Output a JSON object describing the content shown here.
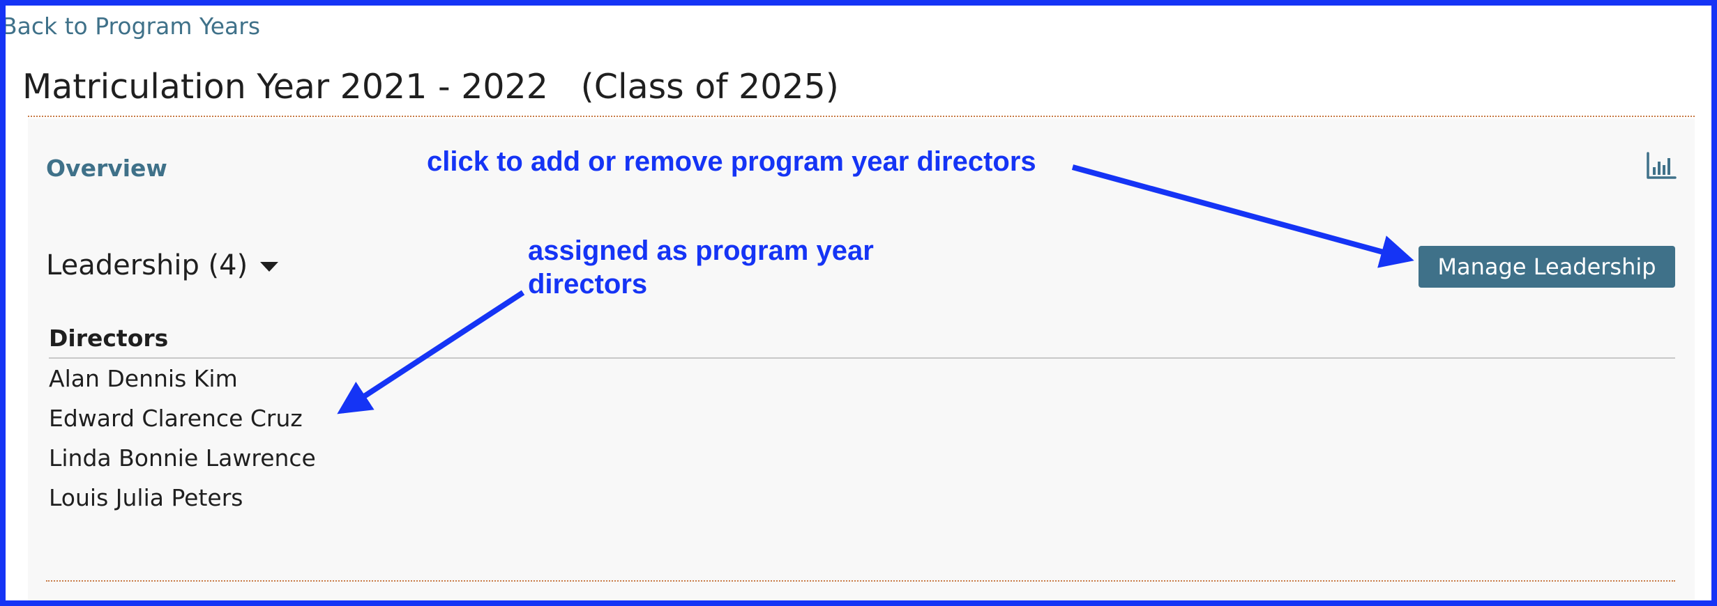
{
  "nav": {
    "back_label": "Back to Program Years"
  },
  "page": {
    "title": "Matriculation Year 2021 - 2022   (Class of 2025)"
  },
  "overview": {
    "label": "Overview",
    "chart_icon": "bar-chart-icon"
  },
  "leadership": {
    "title": "Leadership (4)",
    "toggle_icon": "caret-down-icon",
    "manage_label": "Manage Leadership",
    "directors_header": "Directors",
    "directors": [
      "Alan Dennis Kim",
      "Edward Clarence Cruz",
      "Linda Bonnie Lawrence",
      "Louis Julia Peters"
    ]
  },
  "annotations": {
    "manage_note": "click to add or remove program year directors",
    "directors_note": "assigned as program year directors"
  },
  "colors": {
    "link": "#3f7189",
    "button_bg": "#3f7189",
    "annotation": "#1534f5",
    "divider": "#c77a45",
    "panel_bg": "#f8f8f8"
  }
}
